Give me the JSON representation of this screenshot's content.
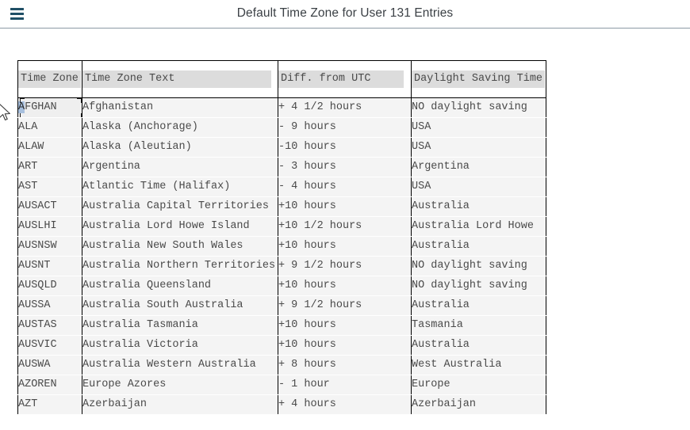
{
  "appbar": {
    "menu_icon": "hamburger-menu-icon",
    "title": "Default Time Zone for User 131 Entries"
  },
  "table": {
    "columns": [
      {
        "key": "code",
        "label": "Time Zone"
      },
      {
        "key": "text",
        "label": "Time Zone Text"
      },
      {
        "key": "diff",
        "label": "Diff. from UTC"
      },
      {
        "key": "dst",
        "label": "Daylight Saving Time"
      }
    ],
    "rows": [
      {
        "code": "AFGHAN",
        "text": "Afghanistan",
        "diff_sign": "+",
        "diff_num": "4",
        "diff_rest": "1/2 hours",
        "dst": "NO daylight saving",
        "focused": true
      },
      {
        "code": "ALA",
        "text": "Alaska (Anchorage)",
        "diff_sign": "-",
        "diff_num": "9",
        "diff_rest": "hours",
        "dst": "USA"
      },
      {
        "code": "ALAW",
        "text": "Alaska (Aleutian)",
        "diff_sign": "-",
        "diff_num": "10",
        "diff_rest": "hours",
        "dst": "USA"
      },
      {
        "code": "ART",
        "text": "Argentina",
        "diff_sign": "-",
        "diff_num": "3",
        "diff_rest": "hours",
        "dst": "Argentina"
      },
      {
        "code": "AST",
        "text": "Atlantic Time (Halifax)",
        "diff_sign": "-",
        "diff_num": "4",
        "diff_rest": "hours",
        "dst": "USA"
      },
      {
        "code": "AUSACT",
        "text": "Australia Capital Territories",
        "diff_sign": "+",
        "diff_num": "10",
        "diff_rest": "hours",
        "dst": "Australia"
      },
      {
        "code": "AUSLHI",
        "text": "Australia Lord Howe Island",
        "diff_sign": "+",
        "diff_num": "10",
        "diff_rest": "1/2 hours",
        "dst": "Australia Lord Howe"
      },
      {
        "code": "AUSNSW",
        "text": "Australia New South Wales",
        "diff_sign": "+",
        "diff_num": "10",
        "diff_rest": "hours",
        "dst": "Australia"
      },
      {
        "code": "AUSNT",
        "text": "Australia Northern Territories",
        "diff_sign": "+",
        "diff_num": "9",
        "diff_rest": "1/2 hours",
        "dst": "NO daylight saving"
      },
      {
        "code": "AUSQLD",
        "text": "Australia Queensland",
        "diff_sign": "+",
        "diff_num": "10",
        "diff_rest": "hours",
        "dst": "NO daylight saving"
      },
      {
        "code": "AUSSA",
        "text": "Australia South Australia",
        "diff_sign": "+",
        "diff_num": "9",
        "diff_rest": "1/2 hours",
        "dst": "Australia"
      },
      {
        "code": "AUSTAS",
        "text": "Australia Tasmania",
        "diff_sign": "+",
        "diff_num": "10",
        "diff_rest": "hours",
        "dst": "Tasmania"
      },
      {
        "code": "AUSVIC",
        "text": "Australia Victoria",
        "diff_sign": "+",
        "diff_num": "10",
        "diff_rest": "hours",
        "dst": "Australia"
      },
      {
        "code": "AUSWA",
        "text": "Australia Western Australia",
        "diff_sign": "+",
        "diff_num": "8",
        "diff_rest": "hours",
        "dst": "West Australia"
      },
      {
        "code": "AZOREN",
        "text": "Europe Azores",
        "diff_sign": "-",
        "diff_num": "1",
        "diff_rest": "hour",
        "dst": "Europe"
      },
      {
        "code": "AZT",
        "text": "Azerbaijan",
        "diff_sign": "+",
        "diff_num": "4",
        "diff_rest": "hours",
        "dst": "Azerbaijan"
      }
    ]
  },
  "colors": {
    "menu_icon": "#1f4f66",
    "title_text": "#3b4045",
    "appbar_border": "#8c9aa5",
    "table_border": "#000000",
    "header_label_bg": "#dcdcdc",
    "cell_bg": "#f4f4f4",
    "cell_text": "#4a4a4a",
    "selection_highlight": "#a8c0de"
  }
}
